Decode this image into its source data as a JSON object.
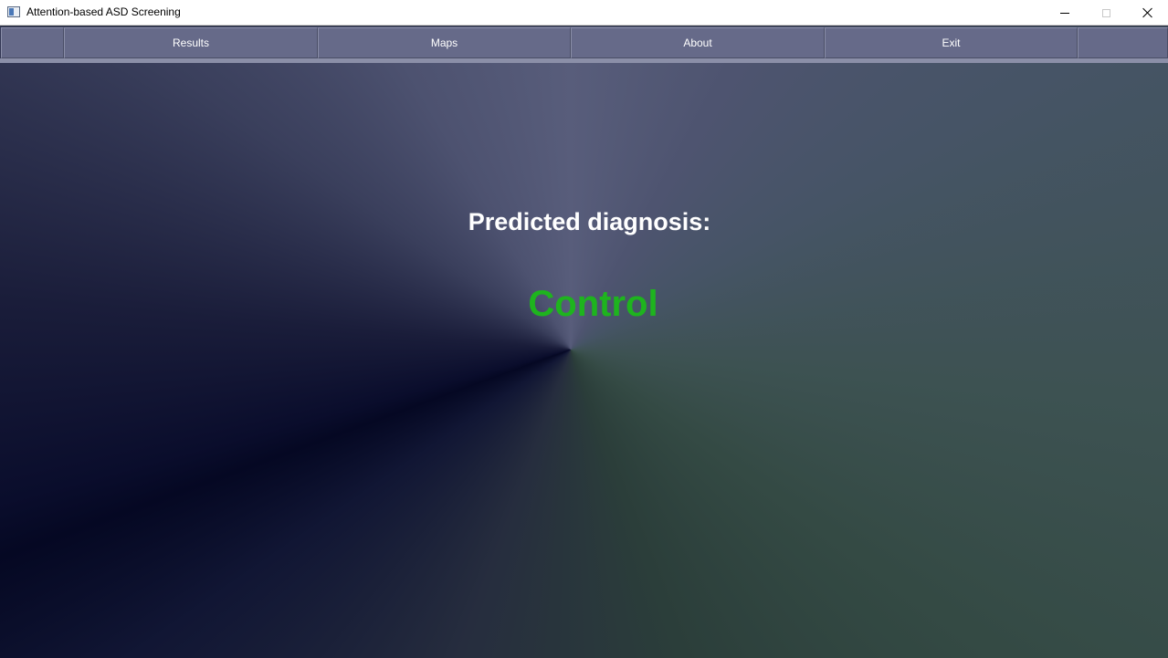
{
  "window": {
    "title": "Attention-based ASD Screening",
    "icon": "app-window-icon",
    "controls": [
      "minimize-icon",
      "maximize-icon",
      "close-icon"
    ]
  },
  "toolbar": {
    "buttons": [
      {
        "label": ""
      },
      {
        "label": "Results"
      },
      {
        "label": "Maps"
      },
      {
        "label": "About"
      },
      {
        "label": "Exit"
      },
      {
        "label": ""
      }
    ]
  },
  "main": {
    "heading": "Predicted diagnosis:",
    "result": "Control"
  },
  "colors": {
    "toolbar_button": "#666a89",
    "result_text": "#1eb41e",
    "heading_text": "#ffffff"
  }
}
